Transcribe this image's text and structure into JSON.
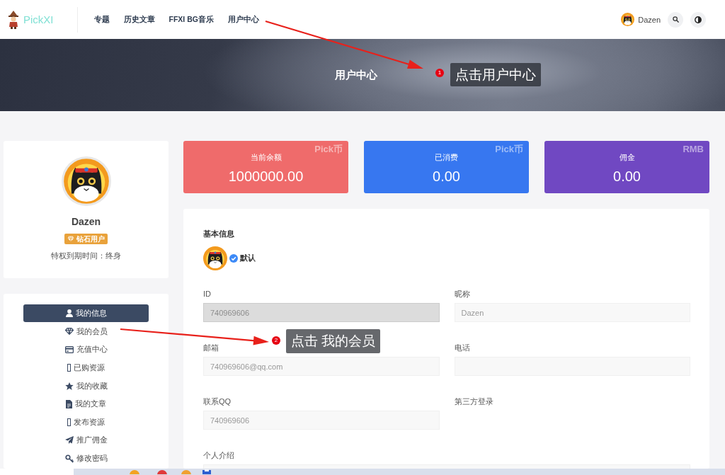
{
  "header": {
    "logo_text": "PickXI",
    "nav": [
      {
        "label": "专题"
      },
      {
        "label": "历史文章"
      },
      {
        "label": "FFXI BG音乐"
      },
      {
        "label": "用户中心"
      }
    ],
    "user_name": "Dazen"
  },
  "banner": {
    "title": "用户中心"
  },
  "profile": {
    "name": "Dazen",
    "badge": "钻石用户",
    "expiry": "特权到期时间：终身"
  },
  "menu": {
    "items": [
      {
        "label": "我的信息",
        "selected": true
      },
      {
        "label": "我的会员",
        "selected": false
      },
      {
        "label": "充值中心",
        "selected": false
      },
      {
        "label": "已购资源",
        "selected": false
      },
      {
        "label": "我的收藏",
        "selected": false
      },
      {
        "label": "我的文章",
        "selected": false
      },
      {
        "label": "发布资源",
        "selected": false
      },
      {
        "label": "推广佣金",
        "selected": false
      },
      {
        "label": "修改密码",
        "selected": false
      }
    ]
  },
  "stats": [
    {
      "label": "当前余额",
      "value": "1000000.00",
      "unit": "Pick币",
      "color": "#ef6b6b"
    },
    {
      "label": "已消费",
      "value": "0.00",
      "unit": "Pick币",
      "color": "#3777f0"
    },
    {
      "label": "佣金",
      "value": "0.00",
      "unit": "RMB",
      "color": "#7048c2"
    }
  ],
  "basic_info": {
    "title": "基本信息",
    "avatar_tag": "默认",
    "fields": [
      {
        "label": "ID",
        "kind": "input",
        "value": "740969606",
        "disabled": true
      },
      {
        "label": "昵称",
        "kind": "input",
        "value": "Dazen",
        "disabled": false
      },
      {
        "label": "邮箱",
        "kind": "input",
        "value": "740969606@qq.com",
        "disabled": false
      },
      {
        "label": "电话",
        "kind": "input",
        "disabled": false
      },
      {
        "label": "联系QQ",
        "kind": "input",
        "value": "740969606",
        "disabled": false
      },
      {
        "label": "第三方登录",
        "kind": "label"
      },
      {
        "label": "个人介绍",
        "kind": "textarea",
        "disabled": false
      }
    ]
  },
  "annotations": [
    {
      "number": "1",
      "text": "点击用户中心"
    },
    {
      "number": "2",
      "text": "点击 我的会员"
    }
  ]
}
